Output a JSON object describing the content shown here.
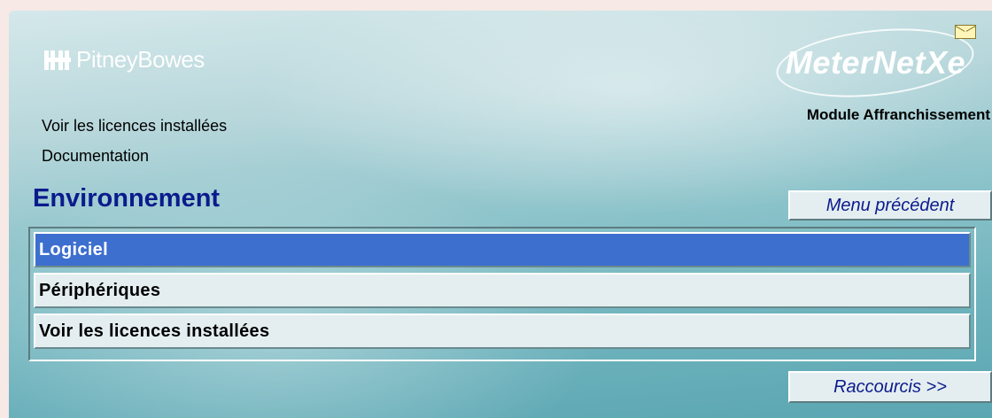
{
  "brand": {
    "left_logo": "PitneyBowes",
    "right_logo": "MeterNet",
    "right_logo_suffix": "Xe"
  },
  "module_title": "Module Affranchissement",
  "links": [
    {
      "label": "Voir les licences installées"
    },
    {
      "label": "Documentation"
    }
  ],
  "section_heading": "Environnement",
  "buttons": {
    "previous_menu": "Menu précédent",
    "shortcuts": "Raccourcis >>"
  },
  "menu": {
    "selected_index": 0,
    "items": [
      {
        "label": "Logiciel"
      },
      {
        "label": "Périphériques"
      },
      {
        "label": "Voir les licences installées"
      }
    ]
  },
  "colors": {
    "heading": "#0b1b8c",
    "selection": "#3d6fce",
    "button_text": "#0b1b8c"
  },
  "icons": [
    "pitney-bowes-logo-icon",
    "envelope-icon"
  ]
}
